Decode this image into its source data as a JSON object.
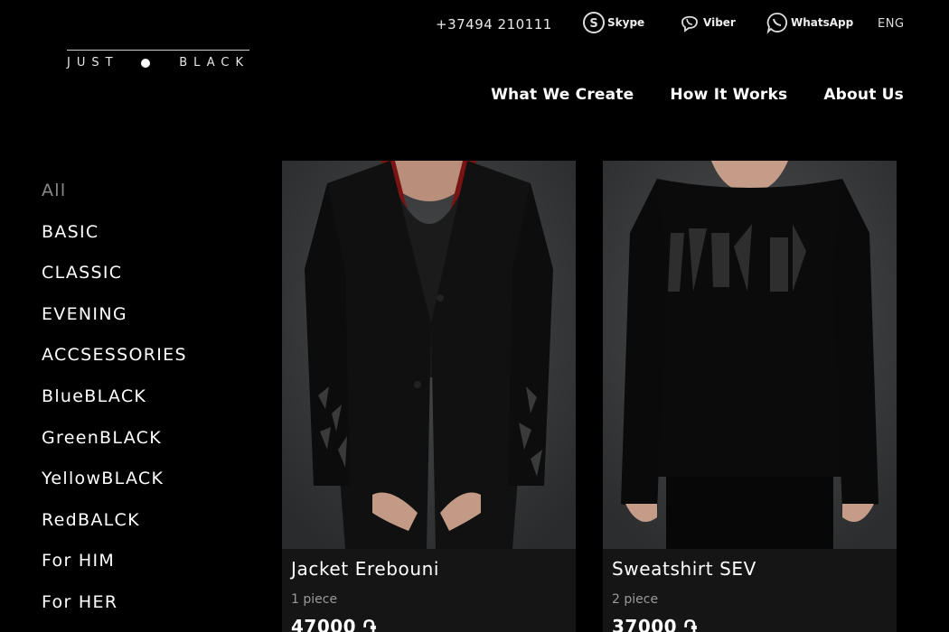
{
  "header": {
    "phone": "+37494 210111",
    "contacts": [
      {
        "label": "Skype",
        "icon": "skype-icon"
      },
      {
        "label": "Viber",
        "icon": "viber-icon"
      },
      {
        "label": "WhatsApp",
        "icon": "whatsapp-icon"
      }
    ],
    "language": "ENG",
    "logo": {
      "left": "JUST",
      "right": "BLACK"
    }
  },
  "nav": [
    "What We Create",
    "How It Works",
    "About Us"
  ],
  "sidebar": {
    "active_index": 0,
    "categories": [
      "All",
      "BASIC",
      "CLASSIC",
      "EVENING",
      "ACCSESSORIES",
      "BlueBLACK",
      "GreenBLACK",
      "YellowBLACK",
      "RedBALCK",
      "For HIM",
      "For HER"
    ]
  },
  "products": [
    {
      "name": "Jacket Erebouni",
      "qty": "1 piece",
      "price": "47000 ֏"
    },
    {
      "name": "Sweatshirt SEV",
      "qty": "2 piece",
      "price": "37000 ֏"
    }
  ],
  "colors": {
    "background": "#000000",
    "card": "#151515",
    "muted": "#8a8a8a"
  }
}
